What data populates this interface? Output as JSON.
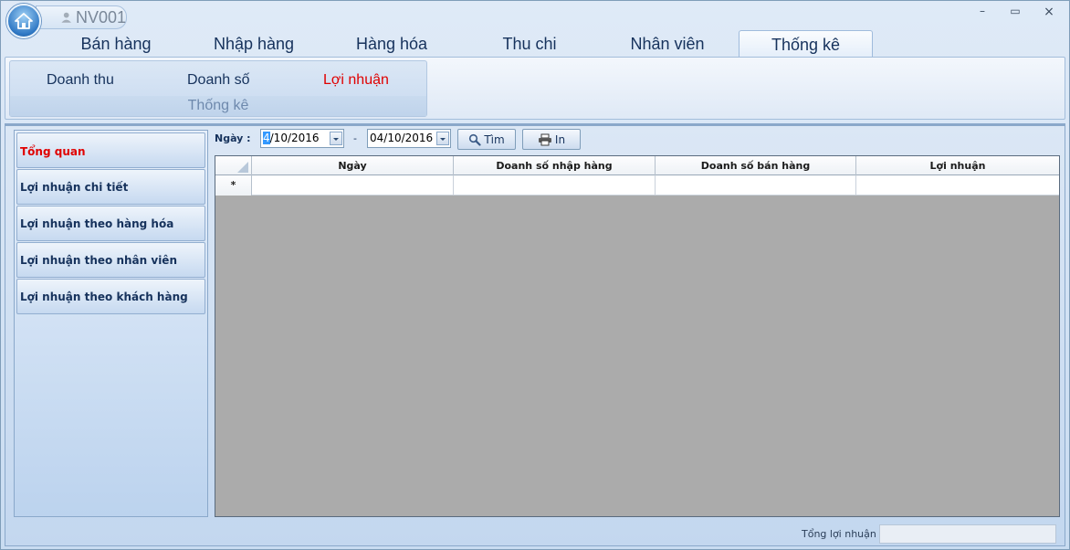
{
  "titlebar": {
    "user_name": "NV001",
    "minimize": "–",
    "maximize": "▭",
    "close": "×"
  },
  "tabs": [
    {
      "label": "Bán hàng"
    },
    {
      "label": "Nhập hàng"
    },
    {
      "label": "Hàng hóa"
    },
    {
      "label": "Thu chi"
    },
    {
      "label": "Nhân viên"
    },
    {
      "label": "Thống kê",
      "active": true
    }
  ],
  "ribbon": {
    "group_label": "Thống kê",
    "buttons": [
      {
        "label": "Doanh thu"
      },
      {
        "label": "Doanh số"
      },
      {
        "label": "Lợi nhuận",
        "active": true
      }
    ]
  },
  "nav": [
    {
      "label": "Tổng quan",
      "active": true
    },
    {
      "label": "Lợi nhuận chi tiết"
    },
    {
      "label": "Lợi nhuận theo hàng hóa"
    },
    {
      "label": "Lợi nhuận theo nhân viên"
    },
    {
      "label": "Lợi nhuận theo khách hàng"
    }
  ],
  "filter": {
    "label": "Ngày :",
    "from_sel": "4",
    "from_rest": "/10/2016",
    "separator": "-",
    "to_value": "04/10/2016",
    "search_label": "Tìm",
    "print_label": "In"
  },
  "grid": {
    "columns": [
      "Ngày",
      "Doanh số nhập hàng",
      "Doanh số bán hàng",
      "Lợi nhuận"
    ],
    "new_row_marker": "*"
  },
  "footer": {
    "total_label": "Tổng lợi nhuận",
    "total_value": ""
  },
  "colors": {
    "accent_red": "#e00000",
    "text_navy": "#16325c",
    "grid_bg": "#ababab"
  }
}
